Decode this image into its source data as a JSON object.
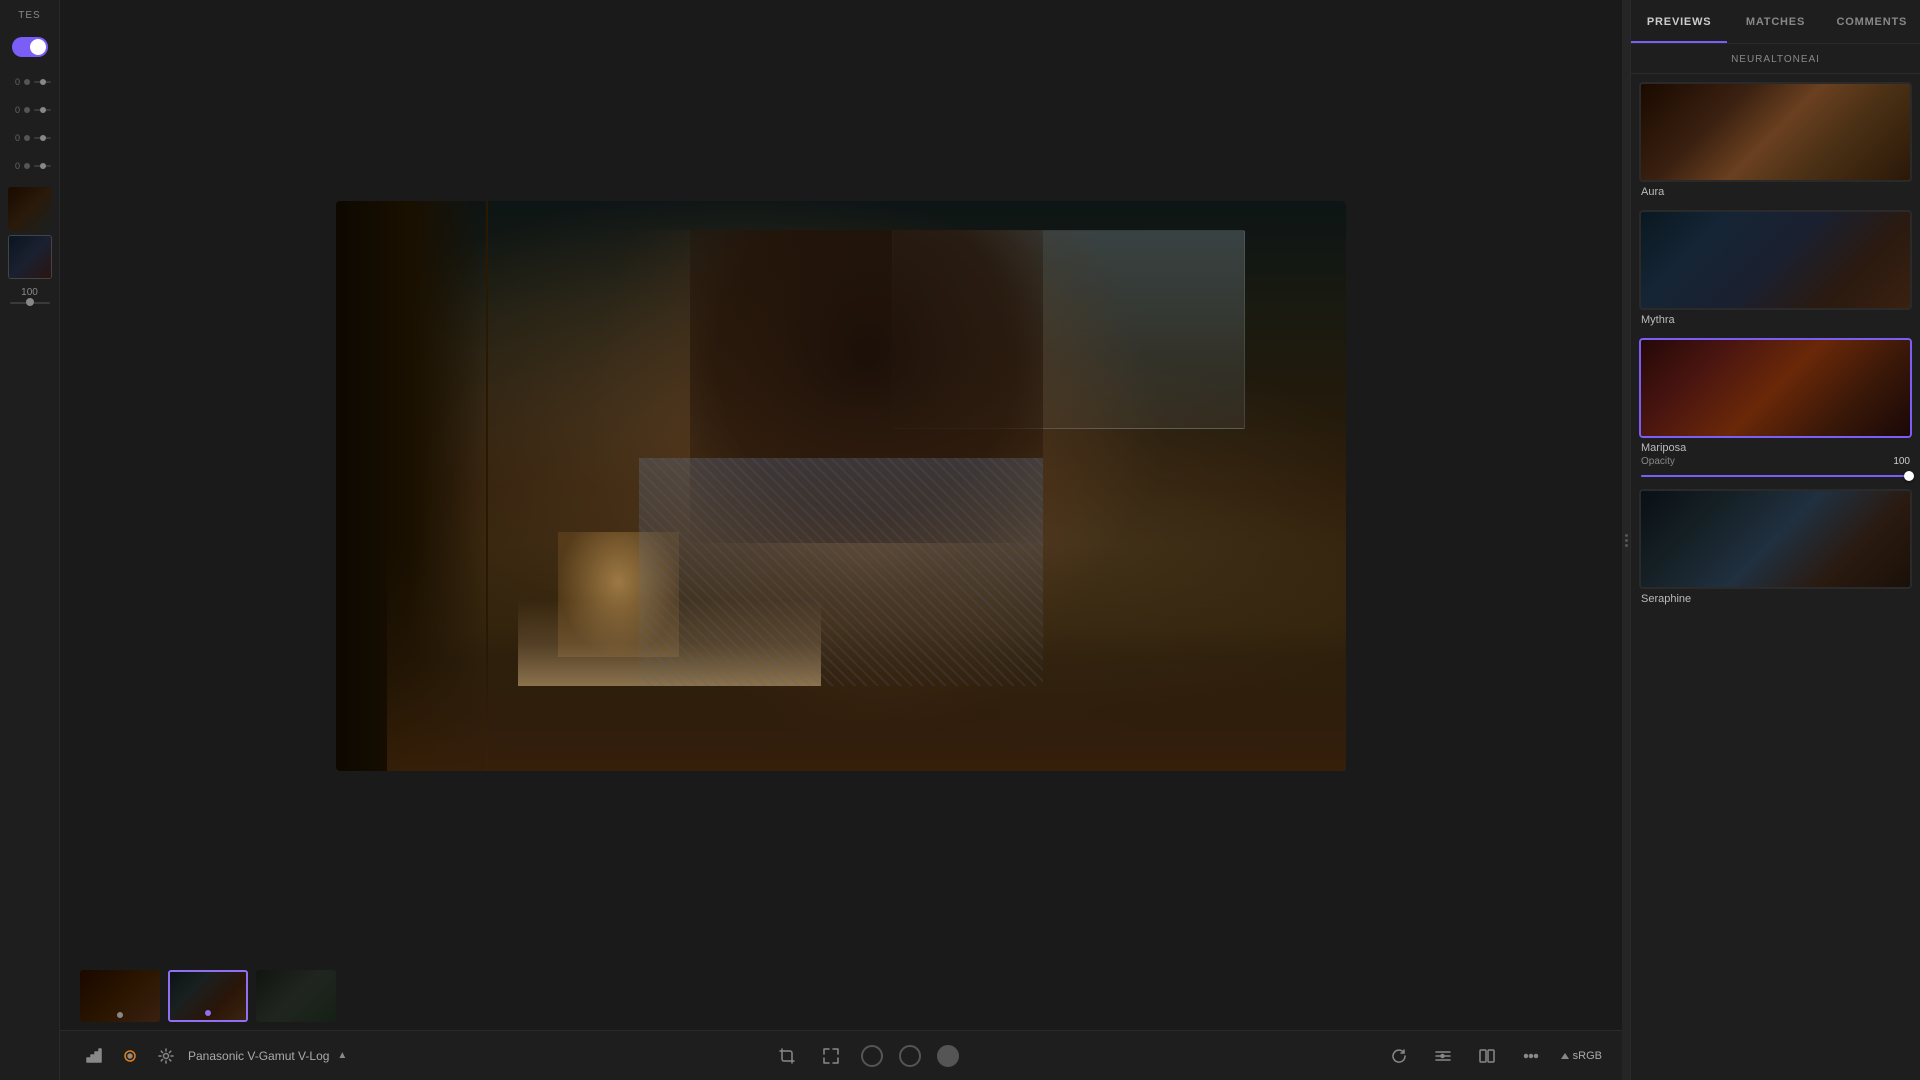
{
  "app": {
    "title": "TES"
  },
  "left_sidebar": {
    "toggle_label": "Toggle",
    "sliders": [
      {
        "value": "0"
      },
      {
        "value": "0"
      },
      {
        "value": "0"
      },
      {
        "value": "0"
      }
    ],
    "master_value": "100"
  },
  "main": {
    "color_space": "Panasonic V-Gamut V-Log",
    "color_space_chevron": "▲",
    "srgb_label": "sRGB",
    "filmstrip": [
      {
        "id": 1,
        "active": false,
        "has_dot": true
      },
      {
        "id": 2,
        "active": true,
        "has_dot": true
      },
      {
        "id": 3,
        "active": false,
        "has_dot": false
      }
    ]
  },
  "right_panel": {
    "tabs": [
      {
        "id": "previews",
        "label": "PREVIEWS",
        "active": true
      },
      {
        "id": "matches",
        "label": "MATCHES",
        "active": false
      },
      {
        "id": "comments",
        "label": "COMMENTS",
        "active": false
      }
    ],
    "ai_label": "NEURALTONEAI",
    "cards": [
      {
        "id": "aura",
        "label": "Aura",
        "selected": false,
        "thumb_class": "thumb-aura"
      },
      {
        "id": "mythra",
        "label": "Mythra",
        "selected": false,
        "thumb_class": "thumb-mythra"
      },
      {
        "id": "mariposa",
        "label": "Mariposa",
        "selected": true,
        "thumb_class": "thumb-mariposa",
        "opacity_label": "Opacity",
        "opacity_value": "100"
      },
      {
        "id": "seraphine",
        "label": "Seraphine",
        "selected": false,
        "thumb_class": "thumb-seraphine"
      }
    ]
  }
}
